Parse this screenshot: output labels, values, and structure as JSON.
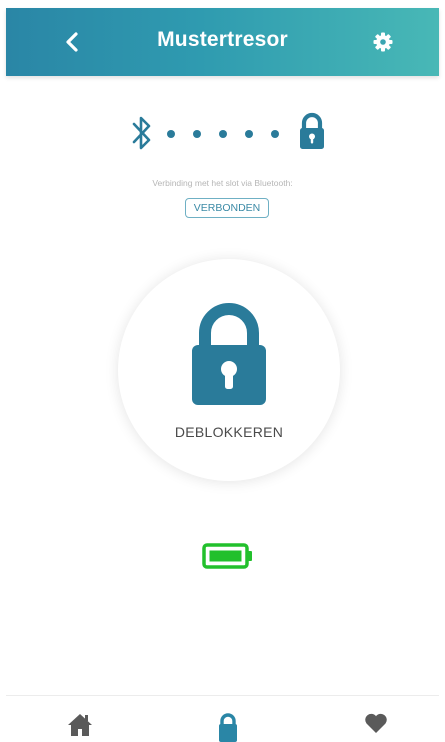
{
  "header": {
    "title": "Mustertresor",
    "back_icon": "chevron-left-icon",
    "settings_icon": "gear-icon"
  },
  "connection": {
    "bluetooth_icon": "bluetooth-icon",
    "lock_icon": "lock-icon",
    "label": "Verbinding met het slot via Bluetooth:",
    "status": "VERBONDEN"
  },
  "unlock": {
    "label": "DEBLOKKEREN",
    "icon": "lock-icon"
  },
  "battery": {
    "icon": "battery-full-icon",
    "color": "#22c02c"
  },
  "tabs": [
    {
      "icon": "home-icon",
      "active": false
    },
    {
      "icon": "lock-icon",
      "active": true
    },
    {
      "icon": "heart-icon",
      "active": false
    }
  ],
  "colors": {
    "accent": "#2a7b9a",
    "header_start": "#2a86a6",
    "header_end": "#48b8b6",
    "inactive_tab": "#5a5a5a"
  }
}
